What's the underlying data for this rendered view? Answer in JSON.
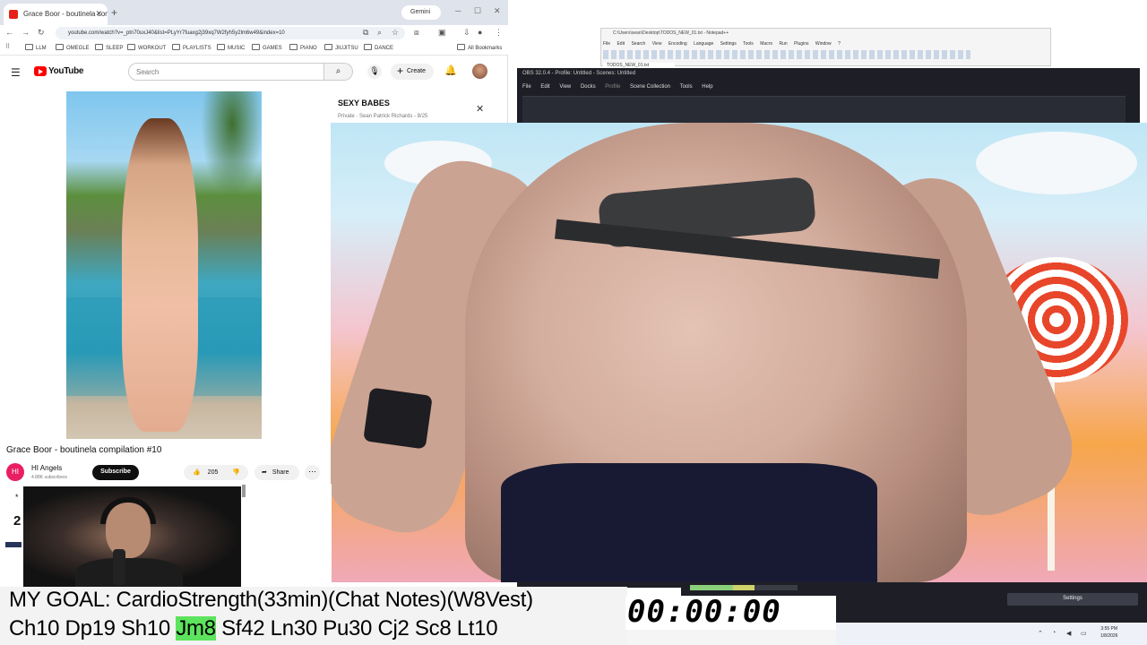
{
  "browser": {
    "tab_title": "Grace Boor - boutinela compila",
    "gemini_label": "Gemini",
    "url": "youtube.com/watch?v=_ptn70uxJ40&list=PLyYr7fuaxg2j39xq7W2fyh5y2lm6w49&index=10",
    "bookmarks": [
      "LLM",
      "OMEGLE",
      "SLEEP",
      "WORKOUT",
      "PLAYLISTS",
      "MUSIC",
      "GAMES",
      "PIANO",
      "JIUJITSU",
      "DANCE"
    ],
    "all_bookmarks": "All Bookmarks"
  },
  "youtube": {
    "logo_text": "YouTube",
    "search_placeholder": "Search",
    "create_label": "Create",
    "video_title": "Grace Boor - boutinela compilation #10",
    "channel_initials": "HI",
    "channel_name": "HI Angels",
    "channel_subs": "4.88K subscribers",
    "subscribe_label": "Subscribe",
    "likes": "205",
    "share_label": "Share",
    "playlist_title": "SEXY BABES",
    "playlist_meta": "Private · Sean Patrick Richards - 8/25"
  },
  "notepad": {
    "title": "C:\\Users\\sean\\Desktop\\TODOS_NEW_01.txt - Notepad++",
    "menu": [
      "File",
      "Edit",
      "Search",
      "View",
      "Encoding",
      "Language",
      "Settings",
      "Tools",
      "Macro",
      "Run",
      "Plugins",
      "Window",
      "?"
    ],
    "tab": "TODOS_NEW_01.txt"
  },
  "obs": {
    "title": "OBS 32.0.4 - Profile: Untitled - Scenes: Untitled",
    "menu": [
      "File",
      "Edit",
      "View",
      "Docks",
      "Profile",
      "Scene Collection",
      "Tools",
      "Help"
    ],
    "settings_label": "Settings"
  },
  "overlay": {
    "goal_line": "MY GOAL: CardioStrength(33min)(Chat Notes)(W8Vest)",
    "stats_before": "Ch10 Dp19 Sh10 ",
    "stats_highlight": "Jm8",
    "stats_after": " Sf42 Ln30 Pu30 Cj2 Sc8 Lt10",
    "timer": "00:00:00",
    "side_star": "*",
    "side_number": "2"
  },
  "taskbar": {
    "time": "3:55 PM",
    "date": "1/8/2026"
  },
  "colors": {
    "highlight": "#5de35d",
    "youtube_red": "#ff0000",
    "obs_dark": "#1e1f26"
  }
}
